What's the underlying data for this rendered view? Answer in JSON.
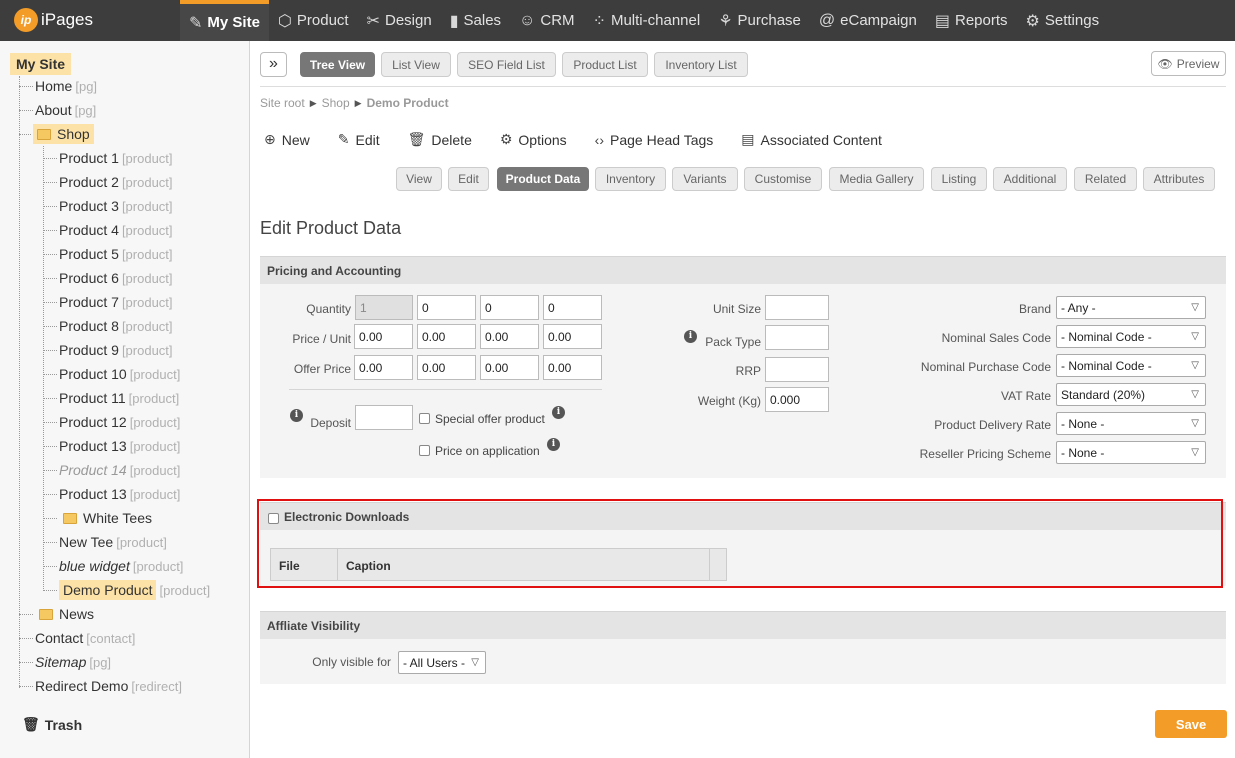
{
  "app": {
    "logo_text": "iPages",
    "logo_mark": "ip"
  },
  "nav": [
    {
      "label": "My Site",
      "icon": "page-edit-icon",
      "glyph": "✎"
    },
    {
      "label": "Product",
      "icon": "box-icon",
      "glyph": "⬡"
    },
    {
      "label": "Design",
      "icon": "brush-icon",
      "glyph": "✂"
    },
    {
      "label": "Sales",
      "icon": "bar-chart-icon",
      "glyph": "▮"
    },
    {
      "label": "CRM",
      "icon": "contact-icon",
      "glyph": "☺"
    },
    {
      "label": "Multi-channel",
      "icon": "network-icon",
      "glyph": "⁘"
    },
    {
      "label": "Purchase",
      "icon": "handshake-icon",
      "glyph": "⚘"
    },
    {
      "label": "eCampaign",
      "icon": "at-icon",
      "glyph": "@"
    },
    {
      "label": "Reports",
      "icon": "chart-icon",
      "glyph": "▤"
    },
    {
      "label": "Settings",
      "icon": "gear-icon",
      "glyph": "⚙"
    }
  ],
  "tree": {
    "root": "My Site",
    "home": {
      "label": "Home",
      "type": "[pg]"
    },
    "about": {
      "label": "About",
      "type": "[pg]"
    },
    "shop": "Shop",
    "products": [
      {
        "label": "Product 1",
        "type": "[product]"
      },
      {
        "label": "Product 2",
        "type": "[product]"
      },
      {
        "label": "Product 3",
        "type": "[product]"
      },
      {
        "label": "Product 4",
        "type": "[product]"
      },
      {
        "label": "Product 5",
        "type": "[product]"
      },
      {
        "label": "Product 6",
        "type": "[product]"
      },
      {
        "label": "Product 7",
        "type": "[product]"
      },
      {
        "label": "Product 8",
        "type": "[product]"
      },
      {
        "label": "Product 9",
        "type": "[product]"
      },
      {
        "label": "Product 10",
        "type": "[product]"
      },
      {
        "label": "Product 11",
        "type": "[product]"
      },
      {
        "label": "Product 12",
        "type": "[product]"
      },
      {
        "label": "Product 13",
        "type": "[product]"
      },
      {
        "label": "Product 14",
        "type": "[product]"
      },
      {
        "label": "Product 13",
        "type": "[product]"
      }
    ],
    "white_tees": "White Tees",
    "new_tee": {
      "label": "New Tee",
      "type": "[product]"
    },
    "blue_widget": {
      "label": "blue widget",
      "type": "[product]"
    },
    "demo_product": {
      "label": "Demo Product",
      "type": "[product]"
    },
    "news": "News",
    "contact": {
      "label": "Contact",
      "type": "[contact]"
    },
    "sitemap": {
      "label": "Sitemap",
      "type": "[pg]"
    },
    "redirect": {
      "label": "Redirect Demo",
      "type": "[redirect]"
    },
    "trash": "Trash"
  },
  "view_tabs": [
    "Tree View",
    "List View",
    "SEO Field List",
    "Product List",
    "Inventory List"
  ],
  "preview": "Preview",
  "breadcrumb": [
    "Site root",
    "Shop",
    "Demo Product"
  ],
  "actions": [
    {
      "label": "New",
      "icon": "plus-circle-icon",
      "glyph": "⊕"
    },
    {
      "label": "Edit",
      "icon": "pencil-icon",
      "glyph": "✎"
    },
    {
      "label": "Delete",
      "icon": "trash-icon",
      "glyph": "🗑"
    },
    {
      "label": "Options",
      "icon": "gear-icon",
      "glyph": "⚙"
    },
    {
      "label": "Page Head Tags",
      "icon": "code-icon",
      "glyph": "‹›"
    },
    {
      "label": "Associated Content",
      "icon": "list-icon",
      "glyph": "▤"
    }
  ],
  "sub_tabs": [
    "View",
    "Edit",
    "Product Data",
    "Inventory",
    "Variants",
    "Customise",
    "Media Gallery",
    "Listing",
    "Additional",
    "Related",
    "Attributes"
  ],
  "page_title": "Edit Product Data",
  "pricing": {
    "heading": "Pricing and Accounting",
    "quantity_label": "Quantity",
    "quantity": [
      "1",
      "0",
      "0",
      "0"
    ],
    "price_label": "Price / Unit",
    "price": [
      "0.00",
      "0.00",
      "0.00",
      "0.00"
    ],
    "offer_label": "Offer Price",
    "offer": [
      "0.00",
      "0.00",
      "0.00",
      "0.00"
    ],
    "deposit_label": "Deposit",
    "deposit": "",
    "special_offer": "Special offer product",
    "price_on_application": "Price on application",
    "unit_size_label": "Unit Size",
    "pack_type_label": "Pack Type",
    "rrp_label": "RRP",
    "weight_label": "Weight (Kg)",
    "weight": "0.000",
    "brand_label": "Brand",
    "brand": "- Any -",
    "nominal_sales_label": "Nominal Sales Code",
    "nominal_sales": "- Nominal Code -",
    "nominal_purchase_label": "Nominal Purchase Code",
    "nominal_purchase": "- Nominal Code -",
    "vat_label": "VAT Rate",
    "vat": "Standard (20%)",
    "delivery_label": "Product Delivery Rate",
    "delivery": "- None -",
    "reseller_label": "Reseller Pricing Scheme",
    "reseller": "- None -"
  },
  "downloads": {
    "heading": "Electronic Downloads",
    "columns": [
      "File",
      "Caption"
    ]
  },
  "affiliate": {
    "heading": "Affliate Visibility",
    "label": "Only visible for",
    "value": "- All Users -"
  },
  "save": "Save",
  "colors": {
    "accent": "#f39c27",
    "highlight": "#e01010",
    "topbar": "#3d3d3d"
  }
}
